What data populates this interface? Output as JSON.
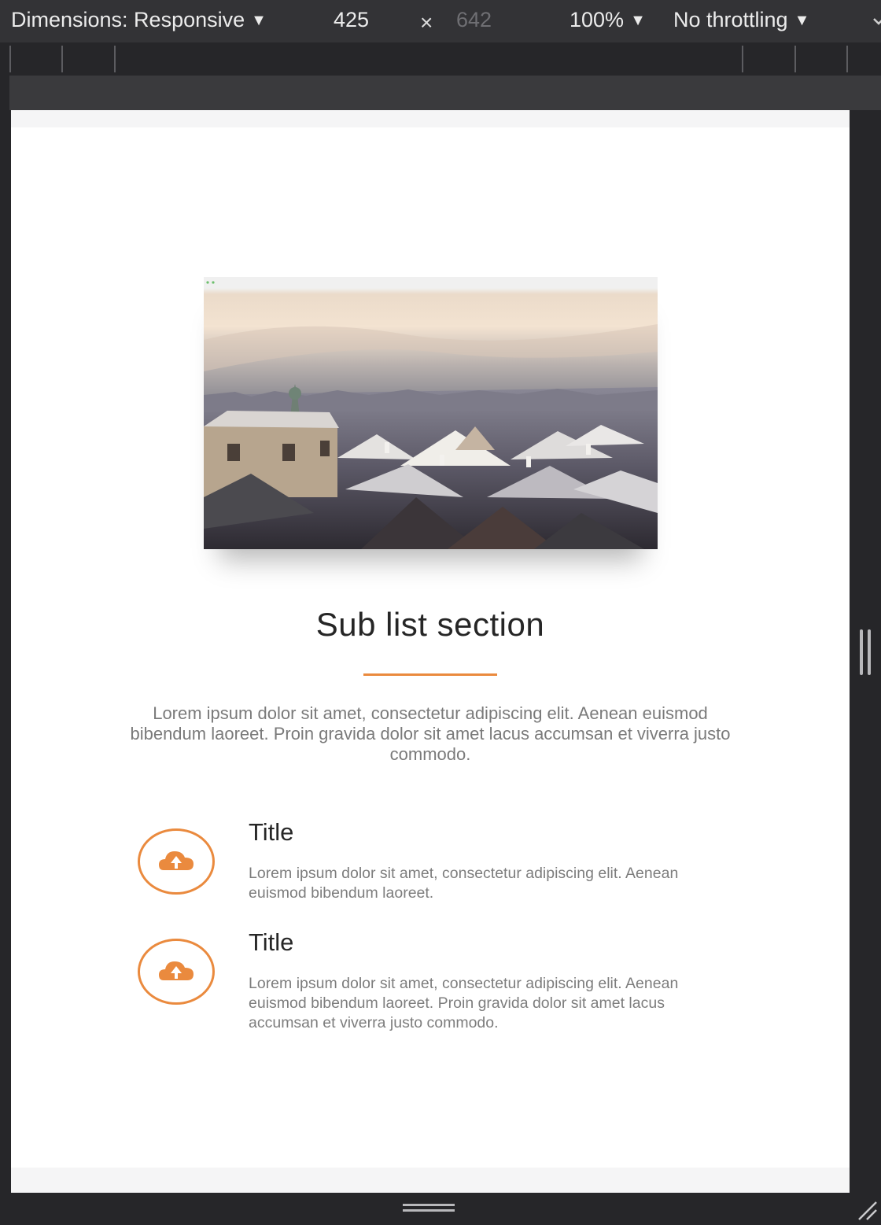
{
  "devtools": {
    "dimensions_label": "Dimensions: Responsive",
    "width_value": "425",
    "times_symbol": "×",
    "height_value": "642",
    "zoom_label": "100%",
    "throttle_label": "No throttling",
    "caret": "▼",
    "icons": {
      "caret": "triangle-down",
      "more": "chevron-down-icon",
      "resize_handle": "double-bar-vertical",
      "bottom_handle": "double-bar-horizontal",
      "corner": "resize-grip-icon"
    }
  },
  "page": {
    "section_title": "Sub list section",
    "intro_text": "Lorem ipsum dolor sit amet, consectetur adipiscing elit. Aenean euismod bibendum laoreet. Proin gravida dolor sit amet lacus accumsan et viverra justo commodo.",
    "features": [
      {
        "title": "Title",
        "text": "Lorem ipsum dolor sit amet, consectetur adipiscing elit. Aenean euismod bibendum laoreet.",
        "icon": "cloud-upload-icon"
      },
      {
        "title": "Title",
        "text": "Lorem ipsum dolor sit amet, consectetur adipiscing elit. Aenean euismod bibendum laoreet. Proin gravida dolor sit amet lacus accumsan et viverra justo commodo.",
        "icon": "cloud-upload-icon"
      }
    ],
    "hero_image": "city-rooftops-photo"
  },
  "colors": {
    "accent": "#ea8a3e",
    "toolbar_bg": "#333336",
    "chrome_dark": "#262629",
    "heading": "#262626",
    "body_text": "#7a7a7a"
  }
}
